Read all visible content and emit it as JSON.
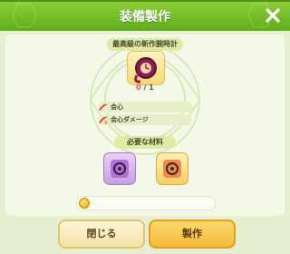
{
  "header": {
    "title": "装備製作"
  },
  "item": {
    "name": "最高級の新作腕時計",
    "owned": "0",
    "required": "/ 1"
  },
  "stats": [
    {
      "label": "会心"
    },
    {
      "label": "会心ダメージ"
    }
  ],
  "materials": {
    "label": "必要な材料",
    "items": [
      {
        "name": "purple-gear-material-icon",
        "color": "#b56fd6"
      },
      {
        "name": "orange-gear-material-icon",
        "color": "#f08a4b"
      }
    ]
  },
  "cost": {
    "value": ""
  },
  "buttons": {
    "close": "閉じる",
    "make": "製作"
  },
  "colors": {
    "accent": "#6bbb22",
    "button_gold": "#f4b93a"
  }
}
